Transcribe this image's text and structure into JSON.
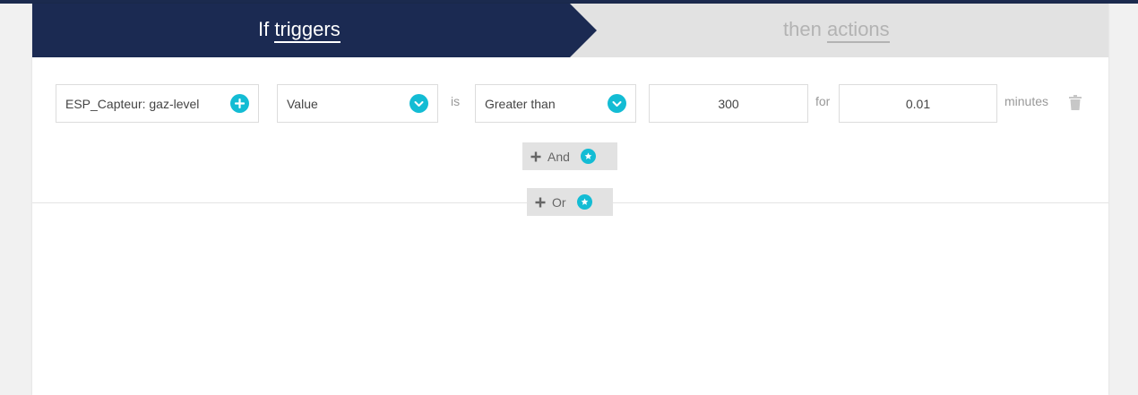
{
  "header": {
    "if_prefix": "If",
    "if_word": "triggers",
    "then_prefix": "then",
    "then_word": "actions"
  },
  "trigger": {
    "device": "ESP_Capteur: gaz-level",
    "attribute": "Value",
    "is_label": "is",
    "operator": "Greater than",
    "value": "300",
    "for_label": "for",
    "duration": "0.01",
    "unit_label": "minutes"
  },
  "buttons": {
    "and_label": "And",
    "or_label": "Or"
  },
  "colors": {
    "navy": "#1b2a52",
    "accent": "#13bcd4",
    "tab_inactive": "#e2e2e2"
  },
  "icons": [
    "plus-circle-icon",
    "chevron-down-icon",
    "trash-icon",
    "plus-icon",
    "star-icon"
  ]
}
